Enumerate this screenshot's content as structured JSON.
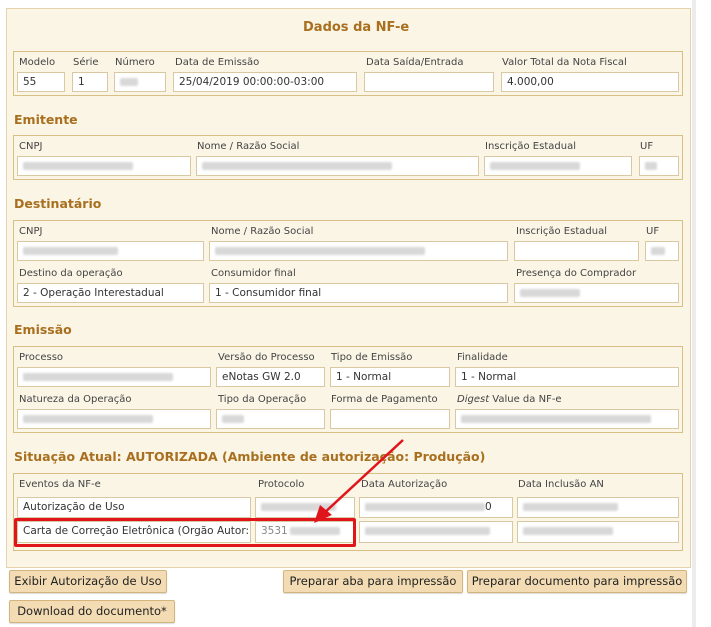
{
  "title": "Dados da NF-e",
  "nfe": {
    "modelo_label": "Modelo",
    "modelo": "55",
    "serie_label": "Série",
    "serie": "1",
    "numero_label": "Número",
    "numero": "",
    "emissao_label": "Data de Emissão",
    "emissao": "25/04/2019 00:00:00-03:00",
    "saida_label": "Data Saída/Entrada",
    "saida": "",
    "valor_label": "Valor Total da Nota Fiscal",
    "valor": "4.000,00"
  },
  "emitente": {
    "heading": "Emitente",
    "cnpj_label": "CNPJ",
    "nome_label": "Nome / Razão Social",
    "ie_label": "Inscrição Estadual",
    "uf_label": "UF"
  },
  "destinatario": {
    "heading": "Destinatário",
    "cnpj_label": "CNPJ",
    "nome_label": "Nome / Razão Social",
    "ie_label": "Inscrição Estadual",
    "uf_label": "UF",
    "destino_label": "Destino da operação",
    "destino": "2 - Operação Interestadual",
    "consumidor_label": "Consumidor final",
    "consumidor": "1 - Consumidor final",
    "presenca_label": "Presença do Comprador"
  },
  "emissao": {
    "heading": "Emissão",
    "processo_label": "Processo",
    "versao_label": "Versão do Processo",
    "versao": "eNotas GW 2.0",
    "tipo_label": "Tipo de Emissão",
    "tipo": "1 - Normal",
    "finalidade_label": "Finalidade",
    "finalidade": "1 - Normal",
    "natureza_label": "Natureza da Operação",
    "tipo_op_label": "Tipo da Operação",
    "pagamento_label": "Forma de Pagamento",
    "digest_label_em": "Digest",
    "digest_label_rest": " Value da NF-e"
  },
  "situacao": {
    "heading": "Situação Atual: AUTORIZADA (Ambiente de autorização: Produção)",
    "col_eventos": "Eventos da NF-e",
    "col_protocolo": "Protocolo",
    "col_data_aut": "Data Autorização",
    "col_data_inc": "Data Inclusão AN",
    "rows": [
      {
        "evento": "Autorização de Uso",
        "protocolo": "",
        "data_aut_tail": "0",
        "data_inc": ""
      },
      {
        "evento": "Carta de Correção Eletrônica (Orgão Autor: DF)",
        "protocolo": "3531",
        "data_aut_tail": "",
        "data_inc": ""
      }
    ]
  },
  "buttons": {
    "exibir": "Exibir Autorização de Uso",
    "aba": "Preparar aba para impressão",
    "documento": "Preparar documento para impressão",
    "download": "Download do documento*"
  },
  "colors": {
    "accent": "#a86f1e",
    "panel": "#fbf5e6",
    "border": "#d8bf86",
    "button": "#f3dcb3",
    "highlight": "#e0151c"
  }
}
